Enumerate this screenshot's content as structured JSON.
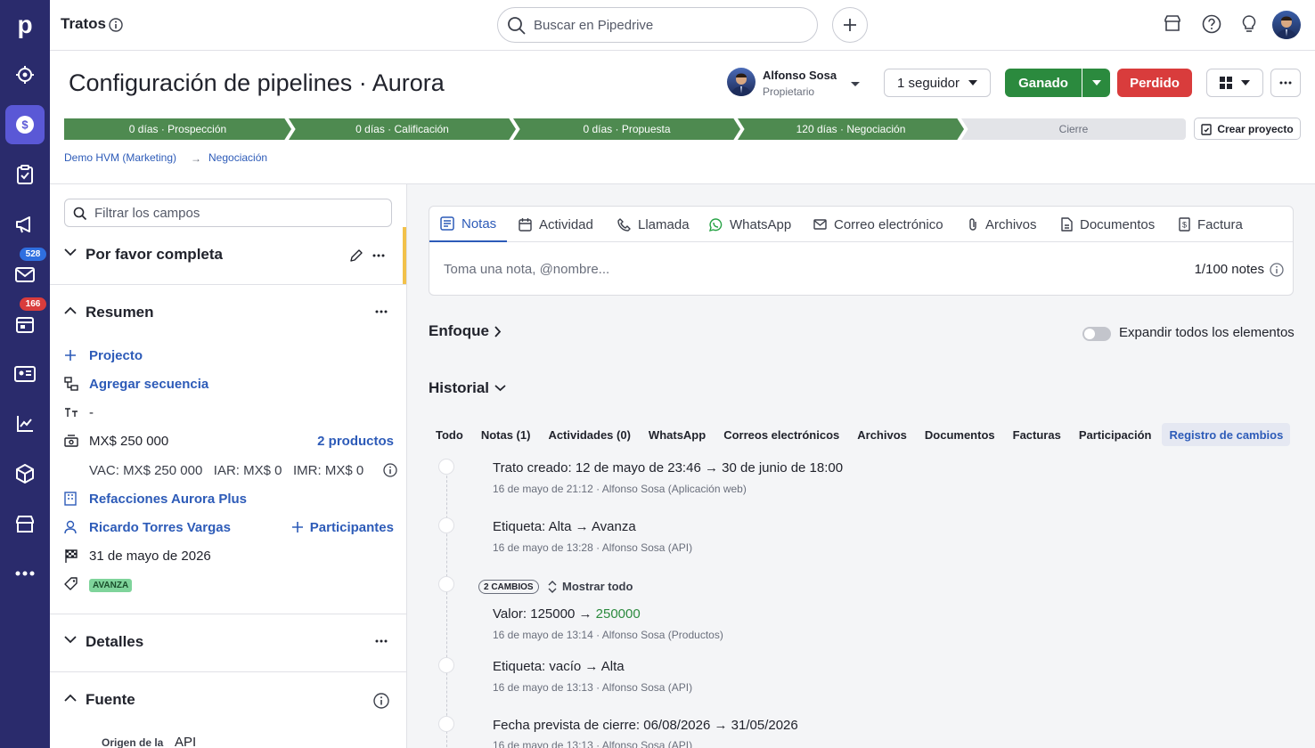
{
  "app": {
    "module_title": "Tratos",
    "search_placeholder": "Buscar en Pipedrive"
  },
  "rail": {
    "badges": {
      "mail": "528",
      "activities": "166"
    }
  },
  "deal": {
    "title": "Configuración de pipelines · Aurora",
    "owner_name": "Alfonso Sosa",
    "owner_role": "Propietario",
    "follower_label": "1 seguidor",
    "won_label": "Ganado",
    "lost_label": "Perdido"
  },
  "pipeline": {
    "stages": [
      {
        "label": "0 días · Prospección",
        "done": true
      },
      {
        "label": "0 días · Calificación",
        "done": true
      },
      {
        "label": "0 días · Propuesta",
        "done": true
      },
      {
        "label": "120 días · Negociación",
        "done": true
      },
      {
        "label": "Cierre",
        "done": false
      }
    ],
    "create_project": "Crear proyecto"
  },
  "breadcrumb": {
    "pipeline": "Demo HVM (Marketing)",
    "stage": "Negociación",
    "arrow": "→"
  },
  "left": {
    "filter_placeholder": "Filtrar los campos",
    "sections": {
      "complete": "Por favor completa",
      "summary": "Resumen",
      "details": "Detalles",
      "source": "Fuente"
    },
    "summary": {
      "project": "Projecto",
      "add_sequence": "Agregar secuencia",
      "title_value": "-",
      "value": "MX$ 250 000",
      "products": "2 productos",
      "recurring": "VAC: MX$ 250 000   IAR: MX$ 0   IMR: MX$ 0",
      "organization": "Refacciones Aurora Plus",
      "person": "Ricardo Torres Vargas",
      "participants": "Participantes",
      "close_date": "31 de mayo de 2026",
      "label_tag": "AVANZA"
    },
    "source": {
      "origin_label": "Origen de la",
      "origin_value": "API"
    }
  },
  "composer": {
    "tabs": [
      {
        "label": "Notas",
        "icon": "note-icon"
      },
      {
        "label": "Actividad",
        "icon": "calendar-icon"
      },
      {
        "label": "Llamada",
        "icon": "phone-icon"
      },
      {
        "label": "WhatsApp",
        "icon": "whatsapp-icon"
      },
      {
        "label": "Correo electrónico",
        "icon": "mail-icon"
      },
      {
        "label": "Archivos",
        "icon": "paperclip-icon"
      },
      {
        "label": "Documentos",
        "icon": "document-icon"
      },
      {
        "label": "Factura",
        "icon": "invoice-icon"
      }
    ],
    "placeholder": "Toma una nota, @nombre...",
    "count": "1/100 notes"
  },
  "focus": {
    "title": "Enfoque",
    "expand_label": "Expandir todos los elementos"
  },
  "history": {
    "title": "Historial",
    "filters": [
      "Todo",
      "Notas (1)",
      "Actividades (0)",
      "WhatsApp",
      "Correos electrónicos",
      "Archivos",
      "Documentos",
      "Facturas",
      "Participación",
      "Registro de cambios"
    ],
    "active_filter": "Registro de cambios",
    "entries": [
      {
        "label": "Trato creado",
        "from": "12 de mayo de 23:46",
        "to": "30 de junio de 18:00",
        "meta": "16 de mayo de 21:12 · Alfonso Sosa (Aplicación web)"
      },
      {
        "label": "Etiqueta",
        "from": "Alta",
        "to": "Avanza",
        "meta": "16 de mayo de 13:28 · Alfonso Sosa (API)"
      },
      {
        "label": "Valor",
        "from": "125000",
        "to": "250000",
        "meta": "16 de mayo de 13:14 · Alfonso Sosa (Productos)"
      },
      {
        "label": "Etiqueta",
        "from": "vacío",
        "to": "Alta",
        "meta": "16 de mayo de 13:13 · Alfonso Sosa (API)"
      },
      {
        "label": "Fecha prevista de cierre",
        "from": "06/08/2026",
        "to": "31/05/2026",
        "meta": "16 de mayo de 13:13 · Alfonso Sosa (API)"
      }
    ],
    "changes_pill": "2 CAMBIOS",
    "show_all": "Mostrar todo"
  },
  "colors": {
    "rail": "#2a2b6c",
    "accent": "#2d5bb8",
    "won": "#2b8a3e",
    "lost": "#d93c3c",
    "stage_done": "#4e8a50"
  }
}
